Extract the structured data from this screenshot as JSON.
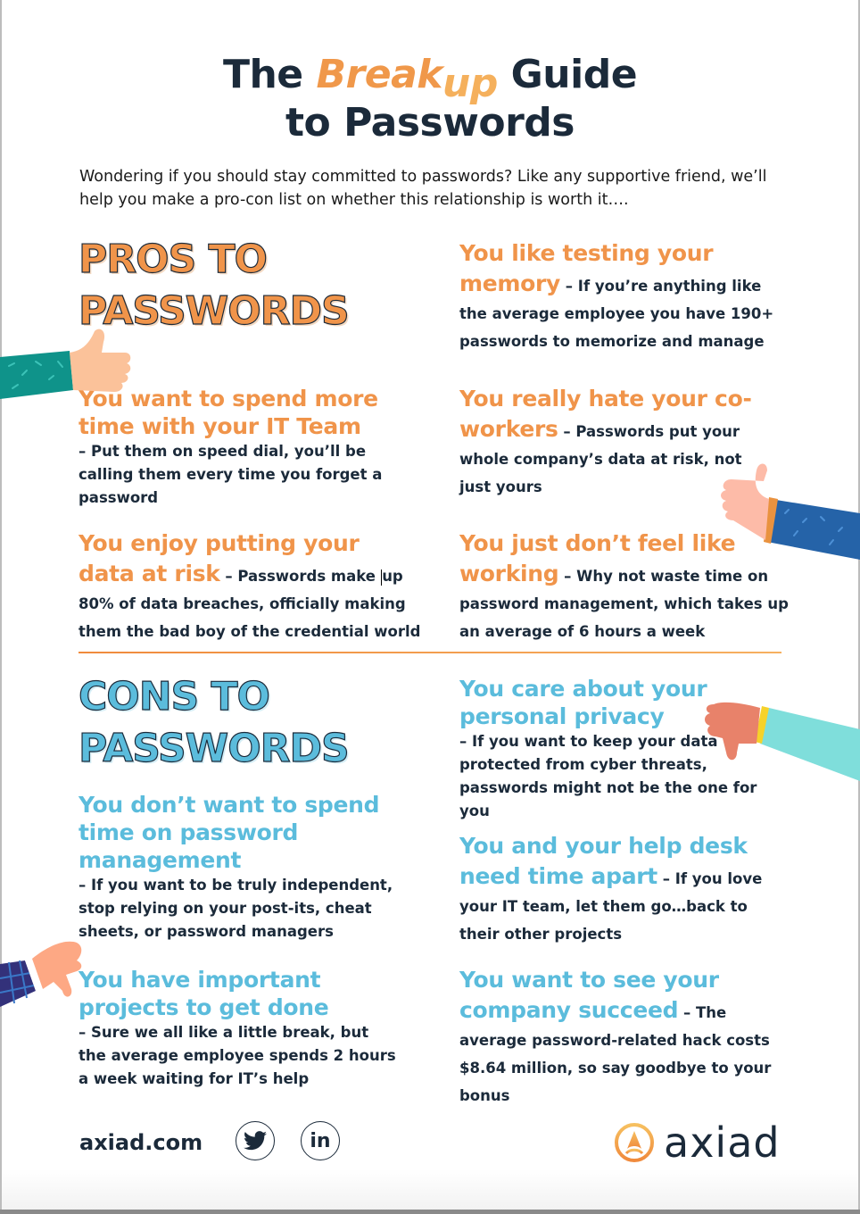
{
  "title": {
    "line1_pre": "The",
    "line1_accent": "Break",
    "line1_accent_up": "up",
    "line1_post": "Guide",
    "line2": "to Passwords"
  },
  "intro": "Wondering if you should stay committed to passwords? Like any supportive friend, we’ll help you make a pro-con list on whether this relationship is worth it….",
  "pros": {
    "heading_line1": "PROS TO",
    "heading_line2": "PASSWORDS",
    "items": [
      {
        "head": "You like testing your memory",
        "desc": " – If you’re anything like the average employee you have 190+ passwords to memorize and manage"
      },
      {
        "head": "You want to spend more time with your IT Team",
        "desc": "– Put them on speed dial, you’ll be calling them every time you forget a password"
      },
      {
        "head": "You really hate your co-workers",
        "desc": " – Passwords put your whole company’s data at risk, not just yours"
      },
      {
        "head": "You enjoy putting your data at risk",
        "desc_pre": " – Passwords make ",
        "desc_post": "up 80% of data breaches, officially making them the bad boy of the credential world"
      },
      {
        "head": "You just don’t feel like working",
        "desc": " – Why not waste time on password management, which takes up an average of 6 hours a week"
      }
    ]
  },
  "cons": {
    "heading_line1": "CONS TO",
    "heading_line2": "PASSWORDS",
    "items": [
      {
        "head": "You care about your personal privacy",
        "desc": "– If you want to keep your data protected from cyber threats, passwords might not be the one for you"
      },
      {
        "head": "You don’t want to spend time on password management",
        "desc": "– If you want to be truly independent, stop relying on your post-its, cheat sheets, or password managers"
      },
      {
        "head": "You and your help desk need time apart",
        "desc": " – If you love your IT team, let them go…back to their other projects"
      },
      {
        "head": "You have important projects to get done",
        "desc": "– Sure we all like a little break, but the average employee spends 2 hours a week waiting for IT’s help"
      },
      {
        "head": "You want to see your company succeed",
        "desc": " – The average password-related hack costs $8.64 million, so say goodbye to your bonus"
      }
    ]
  },
  "footer": {
    "url": "axiad.com",
    "social_icons": [
      "twitter-icon",
      "linkedin-icon"
    ],
    "linkedin_label": "in",
    "logo_text": "axiad"
  },
  "colors": {
    "navy": "#1b2a3a",
    "orange": "#f0944a",
    "blue": "#5bbcdc"
  }
}
